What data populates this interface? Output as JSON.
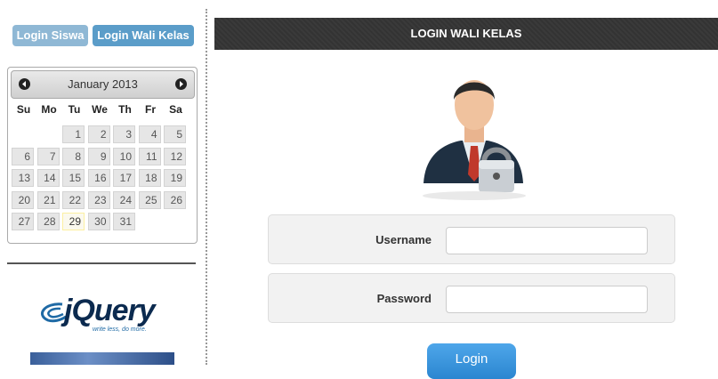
{
  "nav_buttons": {
    "siswa": "Login Siswa",
    "wali": "Login Wali Kelas"
  },
  "calendar": {
    "month_label": "January 2013",
    "weekdays": [
      "Su",
      "Mo",
      "Tu",
      "We",
      "Th",
      "Fr",
      "Sa"
    ],
    "days": [
      "1",
      "2",
      "3",
      "4",
      "5",
      "6",
      "7",
      "8",
      "9",
      "10",
      "11",
      "12",
      "13",
      "14",
      "15",
      "16",
      "17",
      "18",
      "19",
      "20",
      "21",
      "22",
      "23",
      "24",
      "25",
      "26",
      "27",
      "28",
      "29",
      "30",
      "31"
    ],
    "today": "29"
  },
  "logo": {
    "word": "jQuery",
    "tagline": "write less, do more."
  },
  "panel": {
    "title": "LOGIN WALI KELAS"
  },
  "form": {
    "username_label": "Username",
    "username_value": "",
    "password_label": "Password",
    "password_value": "",
    "submit_label": "Login"
  },
  "colors": {
    "accent": "#5b9dc9",
    "header_bar": "#333333",
    "login_button": "#3598e0"
  }
}
